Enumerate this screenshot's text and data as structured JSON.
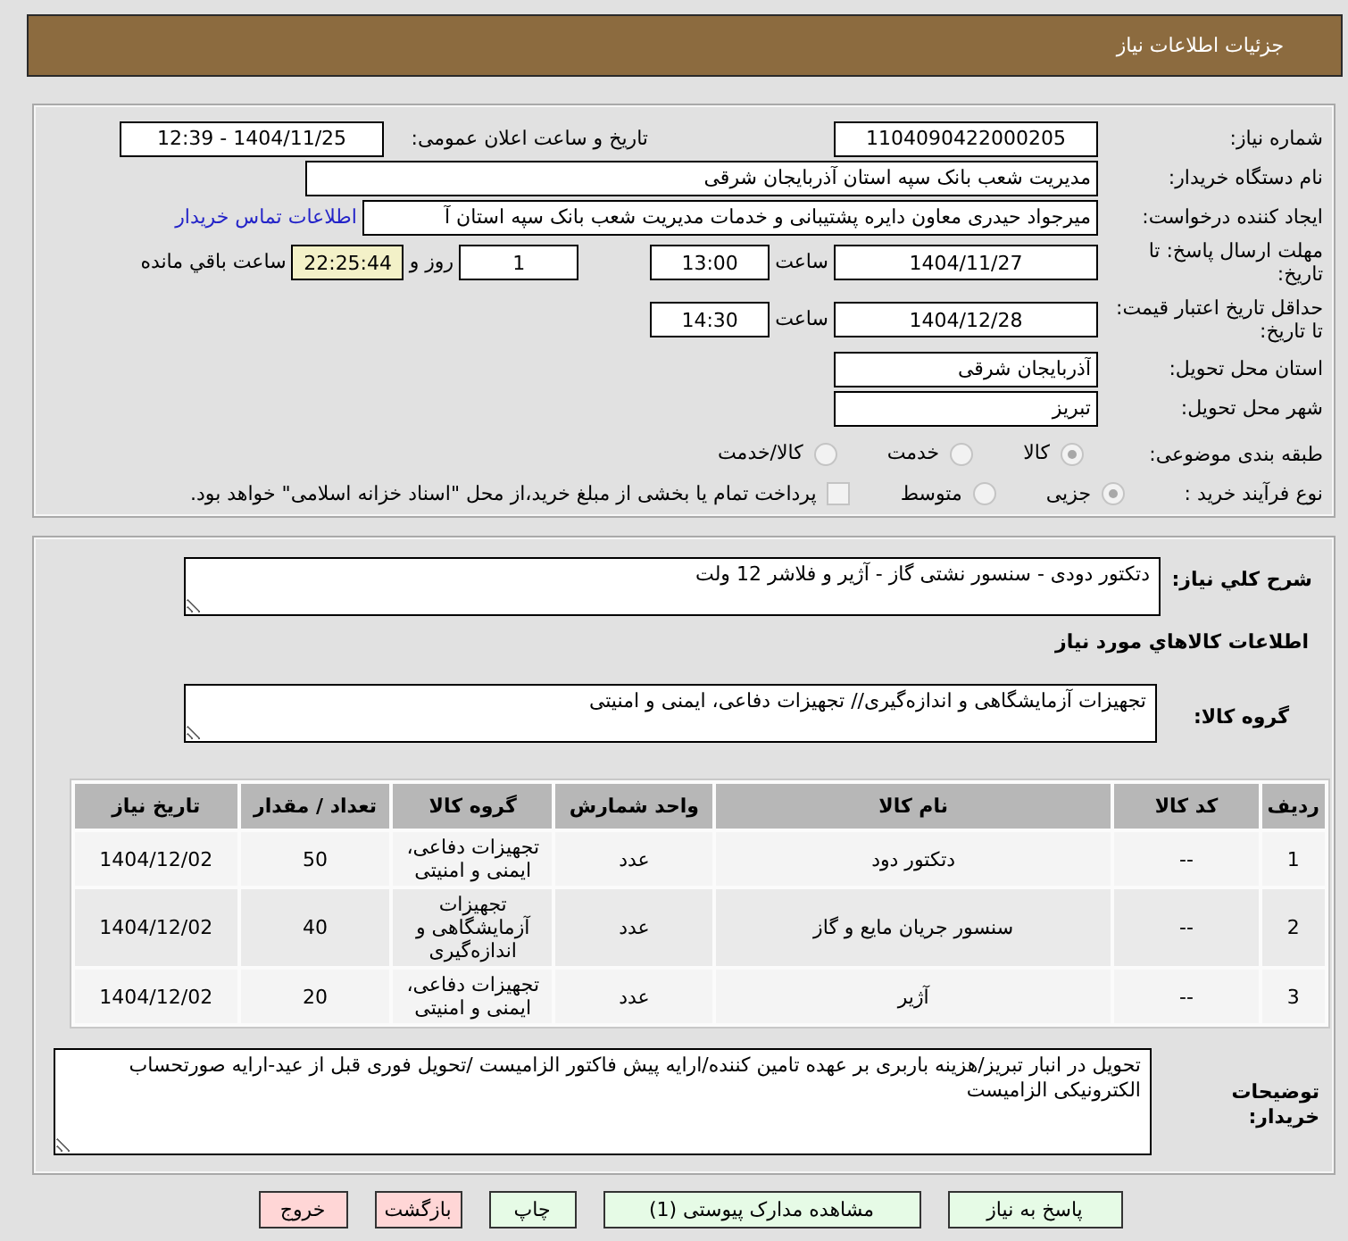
{
  "header": {
    "title": "جزئیات اطلاعات نیاز"
  },
  "details": {
    "need_number": {
      "label": "شماره نیاز:",
      "value": "1104090422000205"
    },
    "announcement": {
      "label": "تاریخ و ساعت اعلان عمومی:",
      "value": "1404/11/25 - 12:39"
    },
    "buyer_organization": {
      "label": "نام دستگاه خریدار:",
      "value": "مدیریت شعب بانک سپه استان آذربایجان شرقی"
    },
    "requester": {
      "label": "ایجاد کننده درخواست:",
      "value": "میرجواد حیدری معاون دایره پشتیبانی و خدمات مدیریت شعب بانک سپه استان آ",
      "link": "اطلاعات تماس خریدار"
    },
    "response_deadline": {
      "label": "مهلت ارسال پاسخ: تا تاریخ:",
      "date": "1404/11/27",
      "time_label": "ساعت",
      "time": "13:00",
      "days": "1",
      "days_label": "روز و",
      "remaining": "22:25:44",
      "remaining_label": "ساعت باقي مانده"
    },
    "price_validity": {
      "label": "حداقل تاریخ اعتبار قیمت: تا تاریخ:",
      "date": "1404/12/28",
      "time_label": "ساعت",
      "time": "14:30"
    },
    "delivery_province": {
      "label": "استان محل تحویل:",
      "value": "آذربایجان شرقی"
    },
    "delivery_city": {
      "label": "شهر محل تحویل:",
      "value": "تبریز"
    },
    "subject_category": {
      "label": "طبقه بندی موضوعی:",
      "options": [
        {
          "label": "کالا",
          "selected": true,
          "disabled": true
        },
        {
          "label": "خدمت",
          "selected": false,
          "disabled": true
        },
        {
          "label": "کالا/خدمت",
          "selected": false,
          "disabled": true
        }
      ]
    },
    "purchase_process": {
      "label": "نوع فرآیند خرید :",
      "options": [
        {
          "label": "جزیی",
          "selected": true,
          "disabled": true
        },
        {
          "label": "متوسط",
          "selected": false,
          "disabled": true
        }
      ],
      "treasury": {
        "label": "پرداخت تمام یا بخشی از مبلغ خرید،از محل \"اسناد خزانه اسلامی\" خواهد بود.",
        "checked": false,
        "disabled": true
      }
    }
  },
  "need_description": {
    "label": "شرح کلي نياز:",
    "value": "دتکتور دودی - سنسور نشتی گاز - آژیر و فلاشر 12 ولت"
  },
  "goods_section_title": "اطلاعات کالاهاي مورد نياز",
  "goods_group": {
    "label": "گروه کالا:",
    "value": "تجهیزات آزمایشگاهی و اندازه‌گیری// تجهیزات دفاعی، ایمنی و امنیتی"
  },
  "items_table": {
    "columns": [
      "ردیف",
      "کد کالا",
      "نام کالا",
      "واحد شمارش",
      "گروه کالا",
      "تعداد / مقدار",
      "تاریخ نیاز"
    ],
    "rows": [
      [
        "1",
        "--",
        "دتکتور دود",
        "عدد",
        "تجهیزات دفاعی، ایمنی و امنیتی",
        "50",
        "1404/12/02"
      ],
      [
        "2",
        "--",
        "سنسور جریان مایع و گاز",
        "عدد",
        "تجهیزات آزمایشگاهی و اندازه‌گیری",
        "40",
        "1404/12/02"
      ],
      [
        "3",
        "--",
        "آژیر",
        "عدد",
        "تجهیزات دفاعی، ایمنی و امنیتی",
        "20",
        "1404/12/02"
      ]
    ]
  },
  "buyer_notes": {
    "label": "توضیحات خریدار:",
    "value": "تحویل در انبار تبریز/هزینه باربری بر عهده تامین کننده/ارایه پیش فاکتور الزامیست /تحویل فوری قبل از عید-ارایه صورتحساب الکترونیکی الزامیست"
  },
  "buttons": [
    {
      "label": "پاسخ به نیاز",
      "kind": "action"
    },
    {
      "label": "مشاهده مدارک پیوستی (1)",
      "kind": "action"
    },
    {
      "label": "چاپ",
      "kind": "action"
    },
    {
      "label": "بازگشت",
      "kind": "exit"
    },
    {
      "label": "خروج",
      "kind": "exit"
    }
  ]
}
